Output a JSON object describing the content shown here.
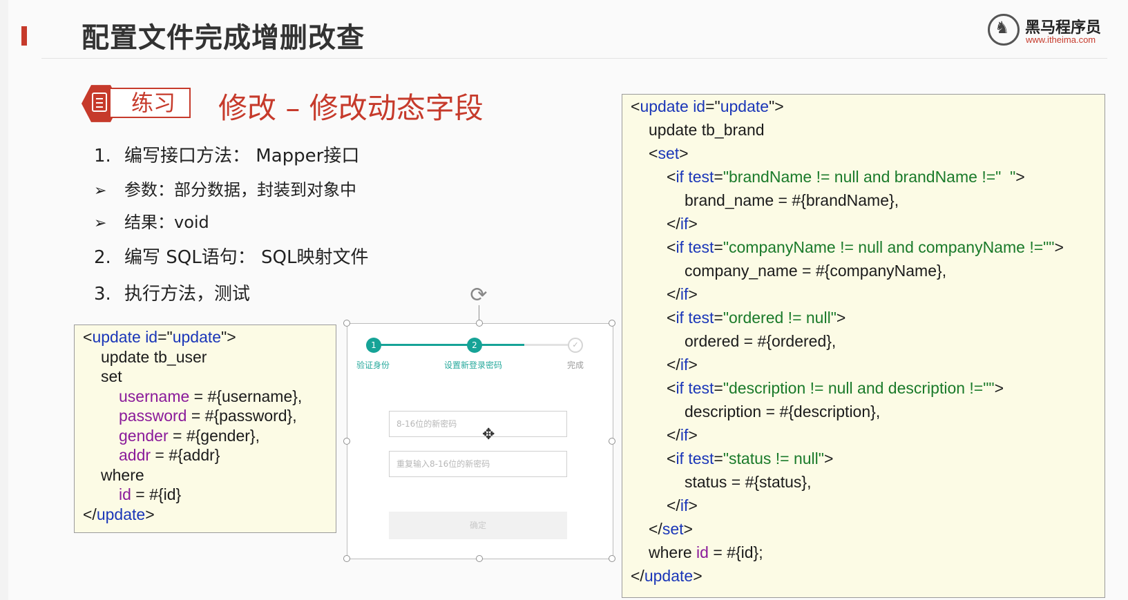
{
  "header": {
    "title": "配置文件完成增删改查",
    "logo_brand": "黑马程序员",
    "logo_url": "www.itheima.com"
  },
  "exercise": {
    "badge_label": "练习",
    "subtitle": "修改 – 修改动态字段"
  },
  "steps": [
    {
      "marker": "1.",
      "text": "编写接口方法：  Mapper接口"
    },
    {
      "marker": "➢",
      "text": "参数：部分数据，封装到对象中"
    },
    {
      "marker": "➢",
      "text": "结果：void"
    },
    {
      "marker": "2.",
      "text": "编写 SQL语句：  SQL映射文件"
    },
    {
      "marker": "3.",
      "text": "执行方法，测试"
    }
  ],
  "code_user": [
    {
      "indent": 0,
      "parts": [
        [
          "t",
          "<"
        ],
        [
          "kw",
          "update"
        ],
        [
          "t",
          " "
        ],
        [
          "kw",
          "id"
        ],
        [
          "t",
          "=\""
        ],
        [
          "kw",
          "update"
        ],
        [
          "t",
          "\">"
        ]
      ]
    },
    {
      "indent": 1,
      "parts": [
        [
          "t",
          "update tb_user"
        ]
      ]
    },
    {
      "indent": 1,
      "parts": [
        [
          "t",
          "set"
        ]
      ]
    },
    {
      "indent": 2,
      "parts": [
        [
          "col",
          "username"
        ],
        [
          "t",
          " = #{username},"
        ]
      ]
    },
    {
      "indent": 2,
      "parts": [
        [
          "col",
          "password"
        ],
        [
          "t",
          " = #{password},"
        ]
      ]
    },
    {
      "indent": 2,
      "parts": [
        [
          "col",
          "gender"
        ],
        [
          "t",
          " = #{gender},"
        ]
      ]
    },
    {
      "indent": 2,
      "parts": [
        [
          "col",
          "addr"
        ],
        [
          "t",
          " = #{addr}"
        ]
      ]
    },
    {
      "indent": 1,
      "parts": [
        [
          "t",
          "where"
        ]
      ]
    },
    {
      "indent": 2,
      "parts": [
        [
          "col",
          "id"
        ],
        [
          "t",
          " = #{id}"
        ]
      ]
    },
    {
      "indent": 0,
      "parts": [
        [
          "t",
          "</"
        ],
        [
          "kw",
          "update"
        ],
        [
          "t",
          ">"
        ]
      ]
    }
  ],
  "code_brand": [
    {
      "indent": 0,
      "parts": [
        [
          "t",
          "<"
        ],
        [
          "kw",
          "update"
        ],
        [
          "t",
          " "
        ],
        [
          "kw",
          "id"
        ],
        [
          "t",
          "=\""
        ],
        [
          "kw",
          "update"
        ],
        [
          "t",
          "\">"
        ]
      ]
    },
    {
      "indent": 1,
      "parts": [
        [
          "t",
          "update tb_brand"
        ]
      ]
    },
    {
      "indent": 1,
      "parts": [
        [
          "t",
          "<"
        ],
        [
          "kw",
          "set"
        ],
        [
          "t",
          ">"
        ]
      ]
    },
    {
      "indent": 2,
      "parts": [
        [
          "t",
          "<"
        ],
        [
          "kw",
          "if"
        ],
        [
          "t",
          " "
        ],
        [
          "kw",
          "test"
        ],
        [
          "t",
          "="
        ],
        [
          "str",
          "\"brandName != null and brandName !=\"  \""
        ],
        [
          "t",
          ">"
        ]
      ]
    },
    {
      "indent": 3,
      "parts": [
        [
          "t",
          "brand_name = #{brandName},"
        ]
      ]
    },
    {
      "indent": 2,
      "parts": [
        [
          "t",
          "</"
        ],
        [
          "kw",
          "if"
        ],
        [
          "t",
          ">"
        ]
      ]
    },
    {
      "indent": 2,
      "parts": [
        [
          "t",
          "<"
        ],
        [
          "kw",
          "if"
        ],
        [
          "t",
          " "
        ],
        [
          "kw",
          "test"
        ],
        [
          "t",
          "="
        ],
        [
          "str",
          "\"companyName != null and companyName !=\"\""
        ],
        [
          "t",
          ">"
        ]
      ]
    },
    {
      "indent": 3,
      "parts": [
        [
          "t",
          "company_name = #{companyName},"
        ]
      ]
    },
    {
      "indent": 2,
      "parts": [
        [
          "t",
          "</"
        ],
        [
          "kw",
          "if"
        ],
        [
          "t",
          ">"
        ]
      ]
    },
    {
      "indent": 2,
      "parts": [
        [
          "t",
          "<"
        ],
        [
          "kw",
          "if"
        ],
        [
          "t",
          " "
        ],
        [
          "kw",
          "test"
        ],
        [
          "t",
          "="
        ],
        [
          "str",
          "\"ordered != null\""
        ],
        [
          "t",
          ">"
        ]
      ]
    },
    {
      "indent": 3,
      "parts": [
        [
          "t",
          "ordered = #{ordered},"
        ]
      ]
    },
    {
      "indent": 2,
      "parts": [
        [
          "t",
          "</"
        ],
        [
          "kw",
          "if"
        ],
        [
          "t",
          ">"
        ]
      ]
    },
    {
      "indent": 2,
      "parts": [
        [
          "t",
          "<"
        ],
        [
          "kw",
          "if"
        ],
        [
          "t",
          " "
        ],
        [
          "kw",
          "test"
        ],
        [
          "t",
          "="
        ],
        [
          "str",
          "\"description != null and description !=\"\""
        ],
        [
          "t",
          ">"
        ]
      ]
    },
    {
      "indent": 3,
      "parts": [
        [
          "t",
          "description = #{description},"
        ]
      ]
    },
    {
      "indent": 2,
      "parts": [
        [
          "t",
          "</"
        ],
        [
          "kw",
          "if"
        ],
        [
          "t",
          ">"
        ]
      ]
    },
    {
      "indent": 2,
      "parts": [
        [
          "t",
          "<"
        ],
        [
          "kw",
          "if"
        ],
        [
          "t",
          " "
        ],
        [
          "kw",
          "test"
        ],
        [
          "t",
          "="
        ],
        [
          "str",
          "\"status != null\""
        ],
        [
          "t",
          ">"
        ]
      ]
    },
    {
      "indent": 3,
      "parts": [
        [
          "t",
          "status = #{status},"
        ]
      ]
    },
    {
      "indent": 2,
      "parts": [
        [
          "t",
          "</"
        ],
        [
          "kw",
          "if"
        ],
        [
          "t",
          ">"
        ]
      ]
    },
    {
      "indent": 1,
      "parts": [
        [
          "t",
          "</"
        ],
        [
          "kw",
          "set"
        ],
        [
          "t",
          ">"
        ]
      ]
    },
    {
      "indent": 1,
      "parts": [
        [
          "t",
          "where "
        ],
        [
          "col",
          "id"
        ],
        [
          "t",
          " = #{id};"
        ]
      ]
    },
    {
      "indent": 0,
      "parts": [
        [
          "t",
          "</"
        ],
        [
          "kw",
          "update"
        ],
        [
          "t",
          ">"
        ]
      ]
    }
  ],
  "reset_form": {
    "steps": [
      {
        "number": "1",
        "label": "验证身份",
        "state": "done"
      },
      {
        "number": "2",
        "label": "设置新登录密码",
        "state": "done"
      },
      {
        "number": "✓",
        "label": "完成",
        "state": "todo"
      }
    ],
    "new_password_placeholder": "8-16位的新密码",
    "repeat_password_placeholder": "重复输入8-16位的新密码",
    "confirm_label": "确定"
  },
  "colors": {
    "accent_red": "#c63a2b",
    "keyword_blue": "#1a36b8",
    "string_green": "#1a7a2a",
    "column_purple": "#8a1a9a",
    "step_teal": "#16a397",
    "code_bg": "#fcfbe5"
  }
}
